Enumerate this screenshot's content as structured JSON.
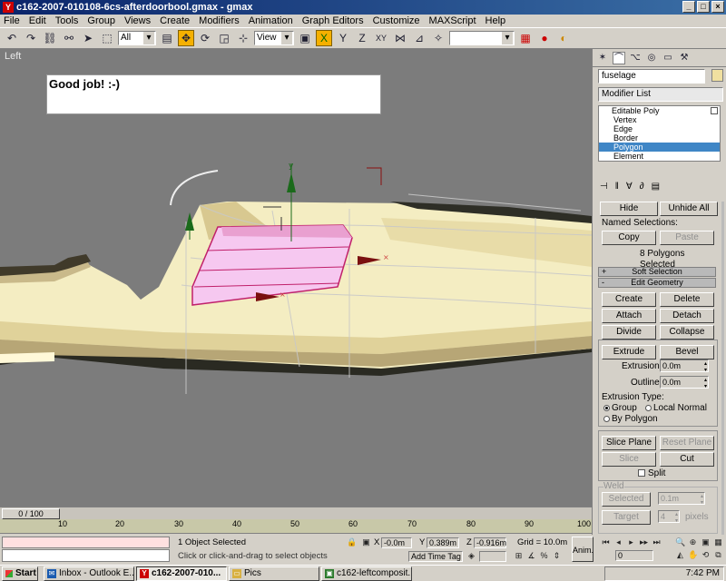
{
  "window": {
    "title": "c162-2007-010108-6cs-afterdoorbool.gmax - gmax",
    "minimize": "_",
    "maximize": "□",
    "close": "×"
  },
  "menu": [
    "File",
    "Edit",
    "Tools",
    "Group",
    "Views",
    "Create",
    "Modifiers",
    "Animation",
    "Graph Editors",
    "Customize",
    "MAXScript",
    "Help"
  ],
  "toolbar": {
    "selection_filter": "All",
    "ref_coord": "View",
    "named_sel": ""
  },
  "viewport": {
    "label": "Left",
    "note": "Good job! :-)"
  },
  "command_panel": {
    "object_name": "fuselage",
    "object_color": "#f0e0a0",
    "modifier_list": "Modifier List",
    "stack": {
      "root": "Editable Poly",
      "items": [
        "Vertex",
        "Edge",
        "Border",
        "Polygon",
        "Element"
      ],
      "selected": "Polygon"
    },
    "hide": "Hide",
    "unhide_all": "Unhide All",
    "named_selections": "Named Selections:",
    "copy": "Copy",
    "paste": "Paste",
    "selected_count": "8 Polygons Selected",
    "soft_selection": "Soft Selection",
    "soft_sign": "+",
    "edit_geometry": "Edit Geometry",
    "edit_sign": "-",
    "create": "Create",
    "delete": "Delete",
    "attach": "Attach",
    "detach": "Detach",
    "divide": "Divide",
    "collapse": "Collapse",
    "extrude": "Extrude",
    "bevel": "Bevel",
    "extrusion_label": "Extrusion:",
    "extrusion_value": "0.0m",
    "outline_label": "Outline:",
    "outline_value": "0.0m",
    "extrusion_type": "Extrusion Type:",
    "group": "Group",
    "local_normal": "Local Normal",
    "by_polygon": "By Polygon",
    "slice_plane": "Slice Plane",
    "reset_plane": "Reset Plane",
    "slice": "Slice",
    "cut": "Cut",
    "split": "Split",
    "weld": "Weld",
    "selected": "Selected",
    "selected_value": "0.1m",
    "target": "Target",
    "target_value": "4",
    "pixels": "pixels"
  },
  "timeline": {
    "frame": "0 / 100",
    "ticks": [
      "10",
      "20",
      "30",
      "40",
      "50",
      "60",
      "70",
      "80",
      "90",
      "100"
    ]
  },
  "status": {
    "selected": "1 Object Selected",
    "prompt": "Click or click-and-drag to select objects",
    "x_label": "X",
    "x_value": "-0.0m",
    "y_label": "Y",
    "y_value": "0.389m",
    "z_label": "Z",
    "z_value": "-0.916m",
    "grid": "Grid = 10.0m",
    "add_time_tag": "Add Time Tag",
    "anim": "Anim.",
    "frame_value": "0"
  },
  "taskbar": {
    "start": "Start",
    "tasks": [
      "Inbox - Outlook E...",
      "c162-2007-010...",
      "Pics",
      "c162-leftcomposit..."
    ],
    "active": 1,
    "clock": "7:42 PM"
  }
}
